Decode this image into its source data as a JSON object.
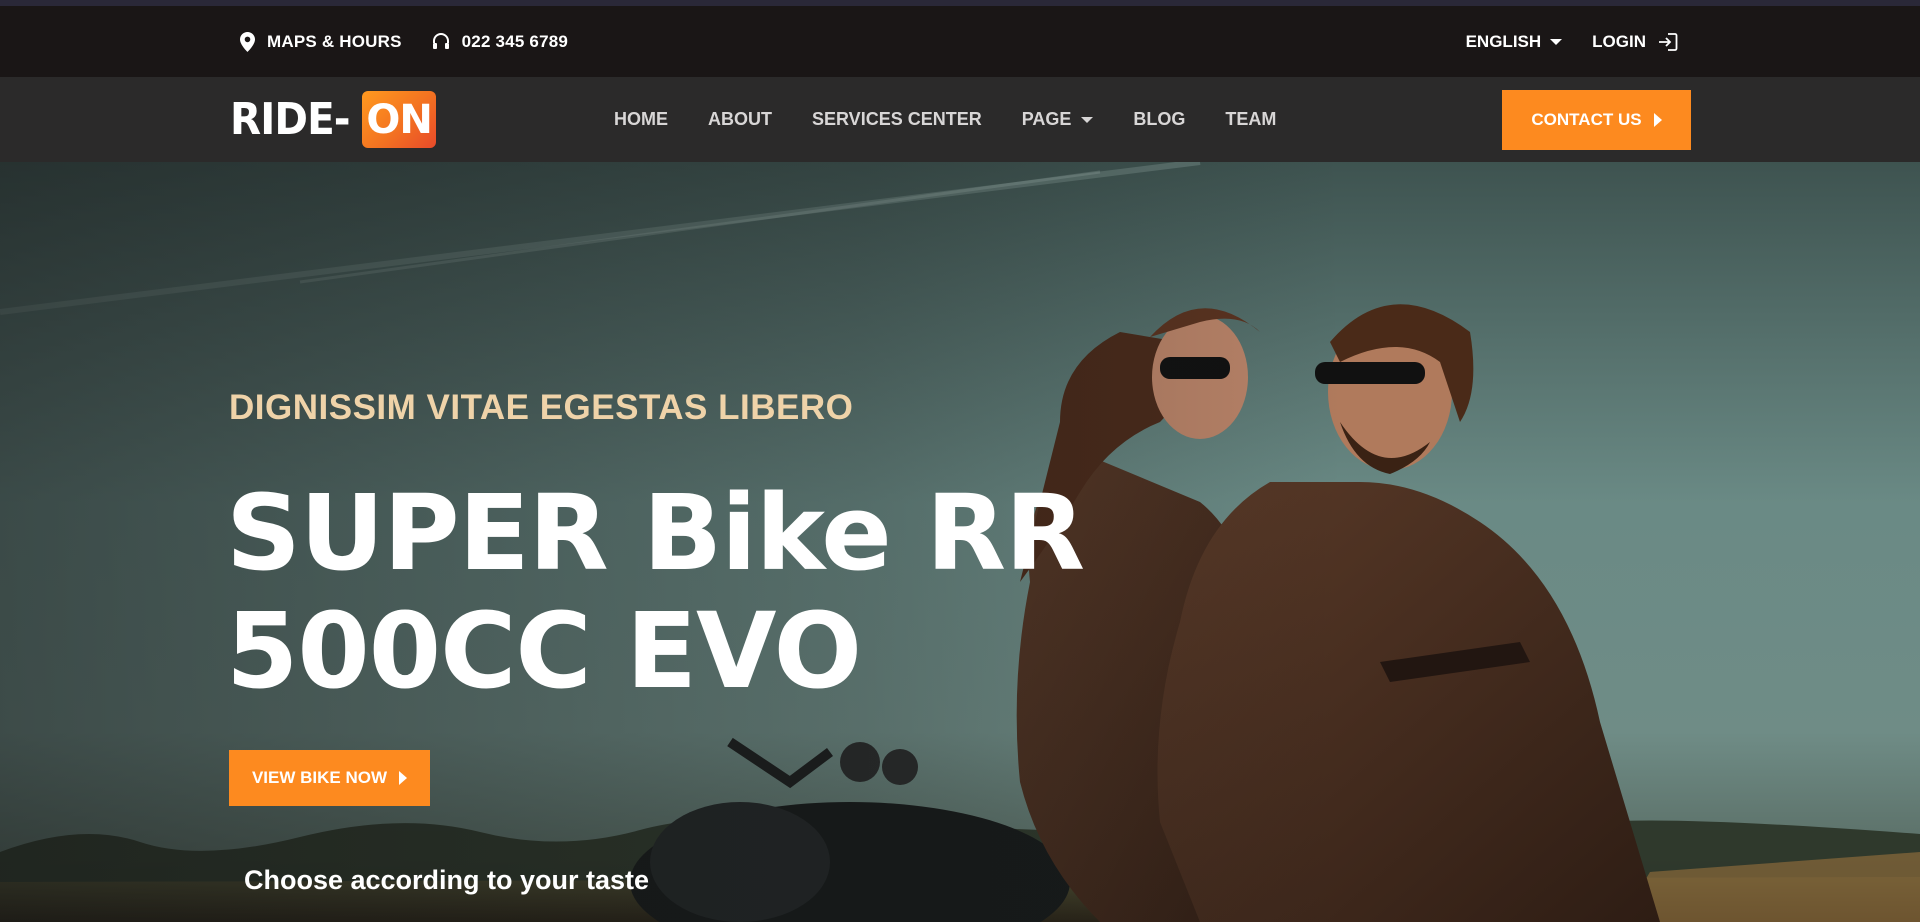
{
  "topbar": {
    "maps_label": "MAPS & HOURS",
    "phone": "022 345 6789",
    "language": "ENGLISH",
    "login_label": "LOGIN"
  },
  "brand": {
    "logo_left": "RIDE-",
    "logo_right": "ON",
    "accent_color": "#fd8a1f"
  },
  "nav": {
    "items": [
      "HOME",
      "ABOUT",
      "SERVICES CENTER",
      "PAGE",
      "BLOG",
      "TEAM"
    ],
    "contact_label": "CONTACT US"
  },
  "hero": {
    "kicker": "DIGNISSIM VITAE EGESTAS LIBERO",
    "headline_line1": "SUPER Bike RR",
    "headline_line2": "500CC EVO",
    "cta_label": "VIEW BIKE NOW",
    "tagline": "Choose according to your taste"
  },
  "icons": {
    "maps": "map-pin-icon",
    "phone": "headphones-icon",
    "login": "login-icon",
    "dropdown": "caret-down-icon",
    "cta_arrow": "play-arrow-icon"
  }
}
